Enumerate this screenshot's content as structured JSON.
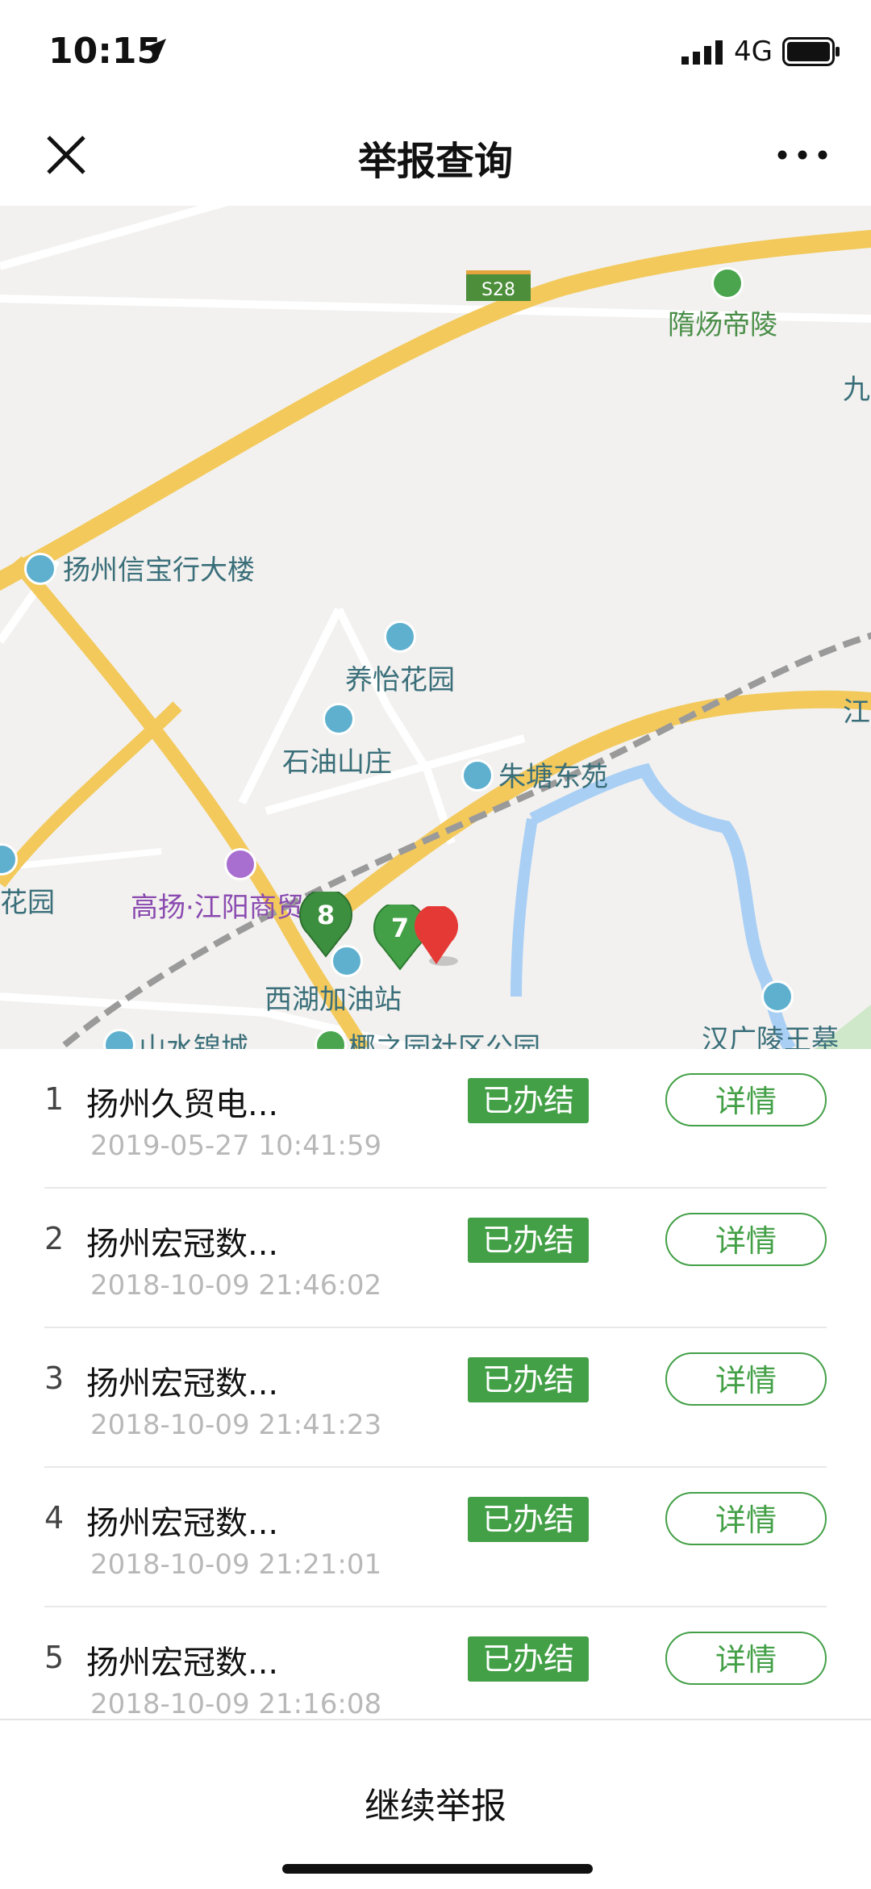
{
  "status_bar": {
    "time": "10:15",
    "network": "4G"
  },
  "nav": {
    "title": "举报查询"
  },
  "map": {
    "labels": {
      "road": "S28",
      "suiyang": "隋炀帝陵",
      "jiu": "九",
      "xinbao": "扬州信宝行大楼",
      "yangyi": "养怡花园",
      "shiyou": "石油山庄",
      "zhutang": "朱塘东苑",
      "jiang": "江",
      "huayuan": "花园",
      "gaoyang": "高扬·江阳商贸城",
      "xihu": "西湖加油站",
      "shanshui": "山水锦城",
      "yezhi": "椰之园社区公园",
      "hanguang": "汉广陵王墓"
    },
    "markers": [
      {
        "label": "8"
      },
      {
        "label": "7"
      }
    ]
  },
  "reports": [
    {
      "index": "1",
      "title": "扬州久贸电...",
      "time": "2019-05-27 10:41:59",
      "status": "已办结",
      "action": "详情"
    },
    {
      "index": "2",
      "title": "扬州宏冠数...",
      "time": "2018-10-09 21:46:02",
      "status": "已办结",
      "action": "详情"
    },
    {
      "index": "3",
      "title": "扬州宏冠数...",
      "time": "2018-10-09 21:41:23",
      "status": "已办结",
      "action": "详情"
    },
    {
      "index": "4",
      "title": "扬州宏冠数...",
      "time": "2018-10-09 21:21:01",
      "status": "已办结",
      "action": "详情"
    },
    {
      "index": "5",
      "title": "扬州宏冠数...",
      "time": "2018-10-09 21:16:08",
      "status": "已办结",
      "action": "详情"
    }
  ],
  "footer": {
    "continue_label": "继续举报"
  },
  "colors": {
    "accent": "#43a047",
    "marker_red": "#e53935"
  }
}
